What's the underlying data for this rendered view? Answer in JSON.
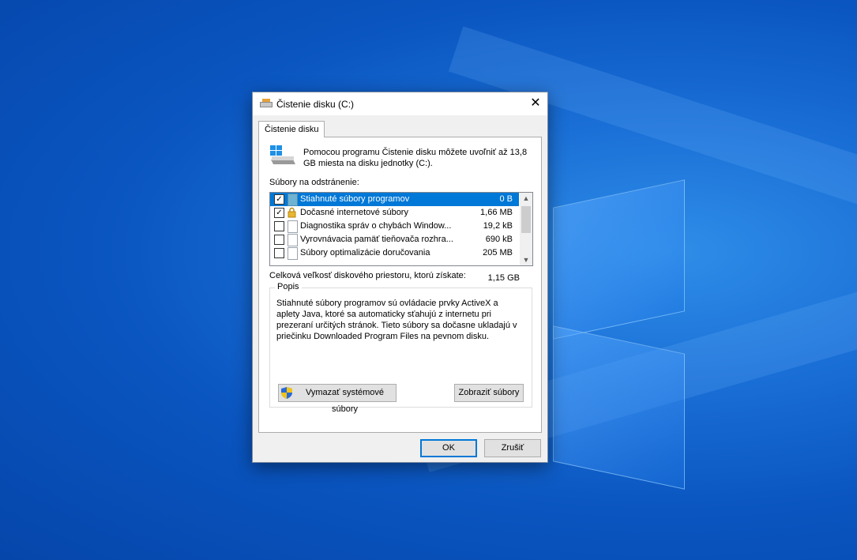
{
  "dialog": {
    "title": "Čistenie disku  (C:)",
    "close_glyph": "✕",
    "tab_label": "Čistenie disku",
    "intro_text": "Pomocou programu Čistenie disku môžete uvoľniť až 13,8 GB miesta na disku jednotky  (C:).",
    "files_label": "Súbory na odstránenie:",
    "files": [
      {
        "name": "Stiahnuté súbory programov",
        "size": "0 B",
        "checked": true,
        "selected": true,
        "icon": "folder-icon"
      },
      {
        "name": "Dočasné internetové súbory",
        "size": "1,66 MB",
        "checked": true,
        "selected": false,
        "icon": "lock-icon"
      },
      {
        "name": "Diagnostika správ o chybách Window...",
        "size": "19,2 kB",
        "checked": false,
        "selected": false,
        "icon": "file-icon"
      },
      {
        "name": "Vyrovnávacia pamäť tieňovača rozhra...",
        "size": "690 kB",
        "checked": false,
        "selected": false,
        "icon": "file-icon"
      },
      {
        "name": "Súbory optimalizácie doručovania",
        "size": "205 MB",
        "checked": false,
        "selected": false,
        "icon": "file-icon"
      }
    ],
    "check_glyph": "✓",
    "total_label": "Celková veľkosť diskového priestoru, ktorú získate:",
    "total_value": "1,15 GB",
    "description_title": "Popis",
    "description_text": "Stiahnuté súbory programov sú ovládacie prvky ActiveX a aplety Java, ktoré sa automaticky sťahujú z internetu pri prezeraní určitých stránok. Tieto súbory sa dočasne ukladajú v priečinku Downloaded Program Files na pevnom disku.",
    "system_files_button": "Vymazať systémové súbory",
    "view_files_button": "Zobraziť súbory",
    "ok_button": "OK",
    "cancel_button": "Zrušiť"
  },
  "colors": {
    "accent": "#0078d7",
    "desktop": "#0a55c0"
  }
}
